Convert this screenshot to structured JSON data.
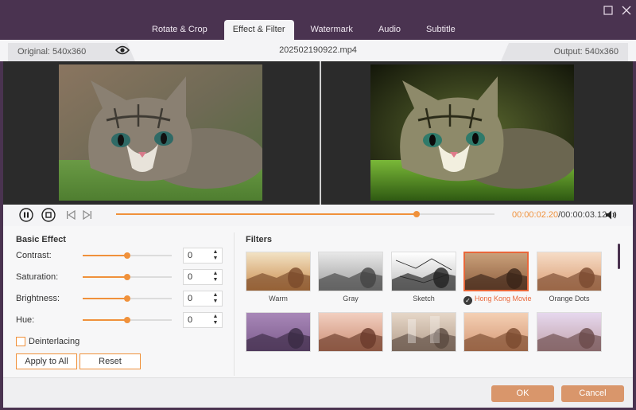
{
  "window": {
    "maximize_icon": "maximize-icon",
    "close_icon": "close-icon"
  },
  "tabs": [
    {
      "label": "Rotate & Crop",
      "active": false
    },
    {
      "label": "Effect & Filter",
      "active": true
    },
    {
      "label": "Watermark",
      "active": false
    },
    {
      "label": "Audio",
      "active": false
    },
    {
      "label": "Subtitle",
      "active": false
    }
  ],
  "info": {
    "original_label": "Original: 540x360",
    "filename": "202502190922.mp4",
    "output_label": "Output: 540x360"
  },
  "playback": {
    "progress_fraction": 0.795,
    "current_time": "00:00:02.20",
    "separator": "/",
    "total_time": "00:00:03.12"
  },
  "basic_effect": {
    "title": "Basic Effect",
    "rows": [
      {
        "label": "Contrast:",
        "value": "0",
        "level": 0.5
      },
      {
        "label": "Saturation:",
        "value": "0",
        "level": 0.5
      },
      {
        "label": "Brightness:",
        "value": "0",
        "level": 0.5
      },
      {
        "label": "Hue:",
        "value": "0",
        "level": 0.5
      }
    ],
    "deinterlacing_label": "Deinterlacing",
    "deinterlacing_checked": false,
    "apply_all_label": "Apply to All",
    "reset_label": "Reset"
  },
  "filters": {
    "title": "Filters",
    "items": [
      {
        "name": "Warm",
        "selected": false,
        "tone": "warm"
      },
      {
        "name": "Gray",
        "selected": false,
        "tone": "gray"
      },
      {
        "name": "Sketch",
        "selected": false,
        "tone": "sketch"
      },
      {
        "name": "Hong Kong Movie",
        "selected": true,
        "tone": "hk"
      },
      {
        "name": "Orange Dots",
        "selected": false,
        "tone": "orange"
      },
      {
        "name": "",
        "selected": false,
        "tone": "purple"
      },
      {
        "name": "",
        "selected": false,
        "tone": "pinkwarm"
      },
      {
        "name": "",
        "selected": false,
        "tone": "blocks"
      },
      {
        "name": "",
        "selected": false,
        "tone": "peach"
      },
      {
        "name": "",
        "selected": false,
        "tone": "lavender"
      }
    ]
  },
  "footer": {
    "ok_label": "OK",
    "cancel_label": "Cancel"
  },
  "colors": {
    "accent": "#f0913b",
    "selected": "#e9673a",
    "titlebar": "#4a3350",
    "button": "#d9966b"
  }
}
